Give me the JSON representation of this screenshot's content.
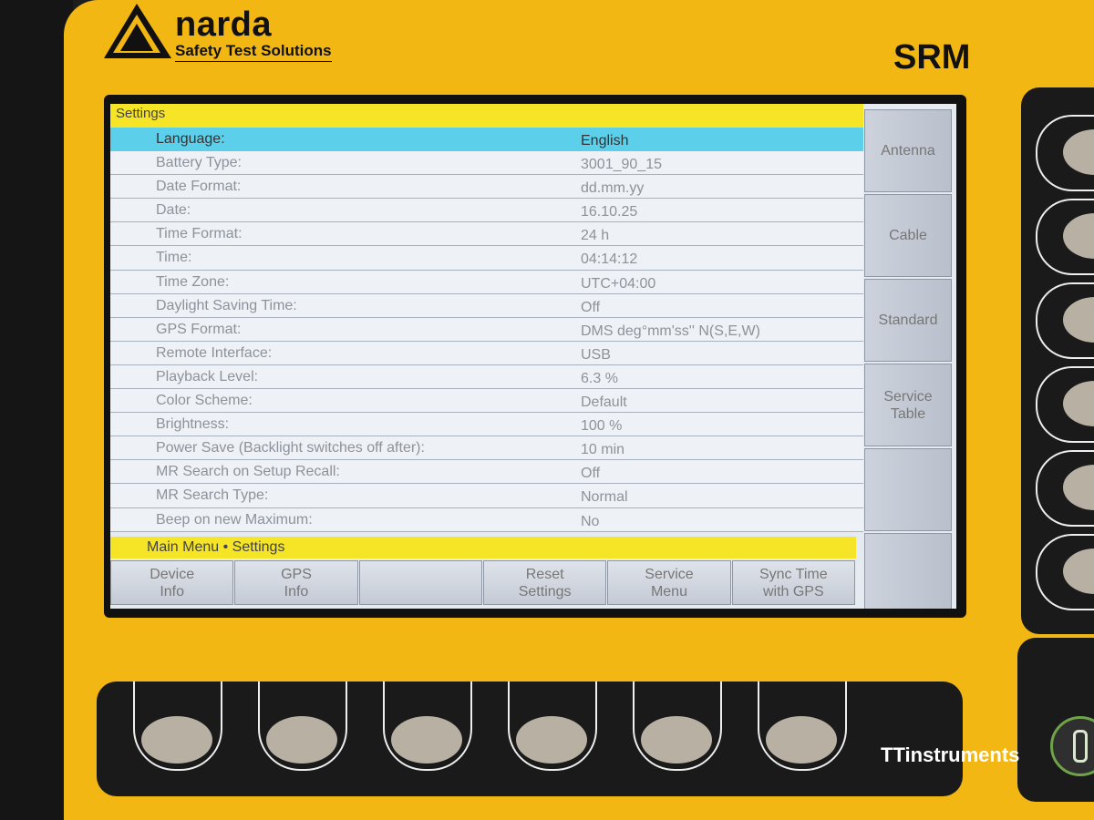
{
  "device": {
    "brand": "narda",
    "brand_sub": "Safety Test Solutions",
    "model": "SRM",
    "watermark": "TTinstruments",
    "body_color": "#f2b713"
  },
  "screen": {
    "title": "Settings",
    "path": "Main Menu • Settings",
    "accent_selected": "#5cd0ea",
    "accent_bar": "#f5e526",
    "rows": [
      {
        "label": "Language:",
        "value": "English",
        "selected": true
      },
      {
        "label": "Battery Type:",
        "value": "3001_90_15"
      },
      {
        "label": "Date Format:",
        "value": "dd.mm.yy"
      },
      {
        "label": "Date:",
        "value": "16.10.25"
      },
      {
        "label": "Time Format:",
        "value": "24 h"
      },
      {
        "label": "Time:",
        "value": "04:14:12"
      },
      {
        "label": "Time Zone:",
        "value": "UTC+04:00"
      },
      {
        "label": "Daylight Saving Time:",
        "value": "Off"
      },
      {
        "label": "GPS Format:",
        "value": "DMS deg°mm'ss'' N(S,E,W)"
      },
      {
        "label": "Remote Interface:",
        "value": "USB"
      },
      {
        "label": "Playback Level:",
        "value": "6.3 %"
      },
      {
        "label": "Color Scheme:",
        "value": "Default"
      },
      {
        "label": "Brightness:",
        "value": "100 %"
      },
      {
        "label": "Power Save (Backlight switches off after):",
        "value": "10 min"
      },
      {
        "label": "MR Search on Setup Recall:",
        "value": "Off"
      },
      {
        "label": "MR Search Type:",
        "value": "Normal"
      },
      {
        "label": "Beep on new Maximum:",
        "value": "No"
      }
    ],
    "side_softkeys": [
      "Antenna",
      "Cable",
      "Standard",
      "Service\nTable",
      "",
      ""
    ],
    "bottom_softkeys": [
      "Device\nInfo",
      "GPS\nInfo",
      "",
      "Reset\nSettings",
      "Service\nMenu",
      "Sync Time\nwith GPS"
    ]
  }
}
